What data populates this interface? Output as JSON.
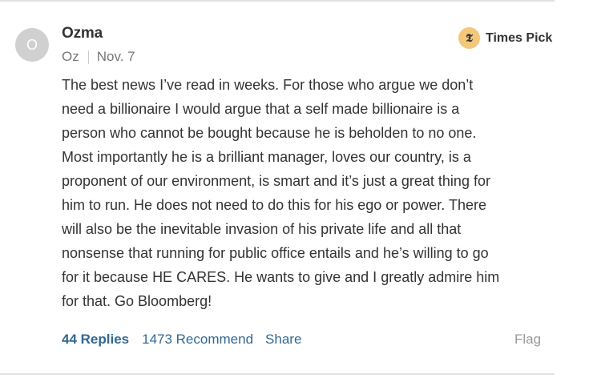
{
  "comment": {
    "avatar_initial": "O",
    "author": "Ozma",
    "location": "Oz",
    "date": "Nov. 7",
    "badge": {
      "icon": "nyt-t-icon",
      "icon_glyph": "𝕿",
      "label": "Times Pick"
    },
    "body_lines": [
      "The best news I’ve read in weeks.  For those who argue we don’t",
      "need a billionaire I would argue that a self made billionaire is a",
      "person who cannot be bought because he is beholden to no one.",
      "Most importantly he is a brilliant manager, loves our country, is a",
      "proponent of our environment, is smart and it’s just a great thing for",
      "him to run.  He does not need to do this for his ego or power.  There",
      "will also be the inevitable invasion of his private life and all that",
      "nonsense that running for public office entails and he’s willing to go",
      "for it because HE CARES.  He wants to give and I greatly admire him",
      "for that.  Go Bloomberg!"
    ],
    "actions": {
      "replies": "44 Replies",
      "recommend": "1473 Recommend",
      "share": "Share",
      "flag": "Flag"
    }
  },
  "colors": {
    "link": "#326891",
    "badge_bg": "#f4c87a",
    "avatar_bg": "#d0d0d0"
  }
}
